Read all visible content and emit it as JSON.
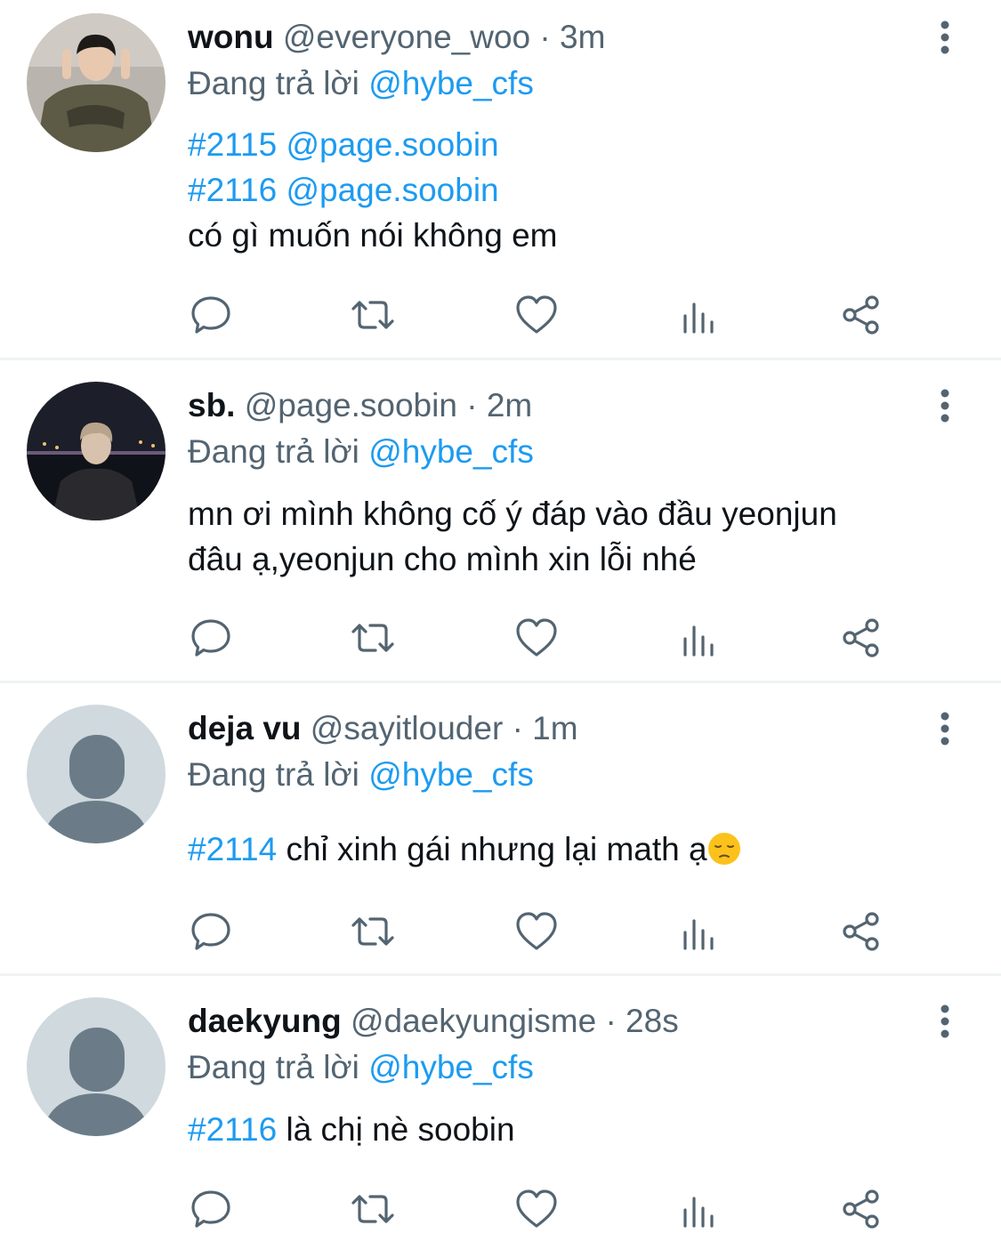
{
  "reply_prefix": "Đang trả lời",
  "colors": {
    "link": "#1d9bf0",
    "secondary": "#536471",
    "text": "#0f1419"
  },
  "icons": [
    "reply-icon",
    "retweet-icon",
    "like-icon",
    "views-icon",
    "share-icon",
    "more-options-icon"
  ],
  "tweets": [
    {
      "name": "wonu",
      "handle": "@everyone_woo",
      "time": "3m",
      "reply_to": "@hybe_cfs",
      "lines": [
        {
          "tag": "#2115",
          "mention": "@page.soobin"
        },
        {
          "tag": "#2116",
          "mention": "@page.soobin"
        },
        {
          "text": "có gì muốn nói không em"
        }
      ]
    },
    {
      "name": "sb.",
      "handle": "@page.soobin",
      "time": "2m",
      "reply_to": "@hybe_cfs",
      "lines": [
        {
          "text": "mn ơi mình không cố ý đáp vào đầu yeonjun"
        },
        {
          "text": "đâu ạ,yeonjun cho mình xin lỗi nhé"
        }
      ]
    },
    {
      "name": "deja vu",
      "handle": "@sayitlouder",
      "time": "1m",
      "reply_to": "@hybe_cfs",
      "tag": "#2114",
      "text": "chỉ xinh gái nhưng lại math ạ",
      "emoji": "pensive-face"
    },
    {
      "name": "daekyung",
      "handle": "@daekyungisme",
      "time": "28s",
      "reply_to": "@hybe_cfs",
      "tag": "#2116",
      "text": "là chị nè soobin"
    }
  ]
}
